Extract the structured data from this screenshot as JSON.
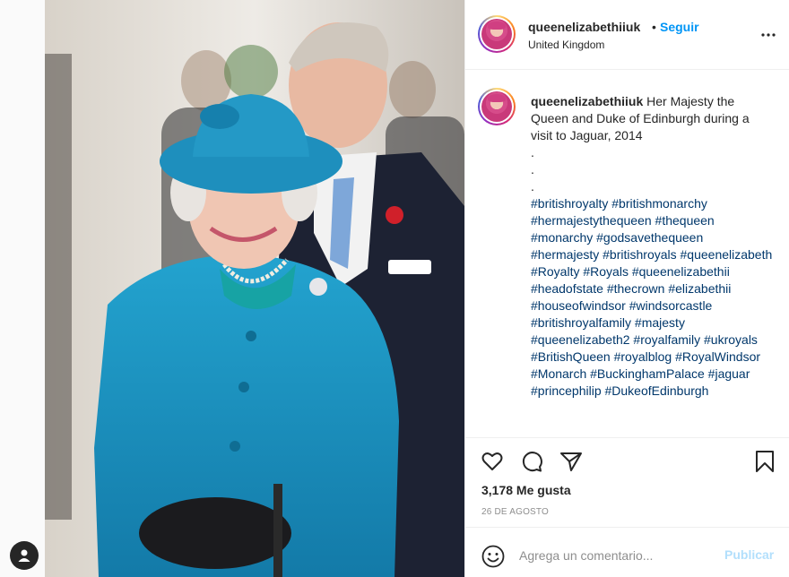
{
  "header": {
    "username": "queenelizabethiiuk",
    "separator": "•",
    "follow_label": "Seguir",
    "location": "United Kingdom",
    "more_icon": "more-horizontal-icon"
  },
  "caption": {
    "username": "queenelizabethiiuk",
    "text": "Her Majesty the Queen and Duke of Edinburgh during a visit to Jaguar, 2014",
    "dots": [
      ".",
      ".",
      "."
    ],
    "hashtags": "#britishroyalty #britishmonarchy #hermajestythequeen #thequeen #monarchy #godsavethequeen #hermajesty #britishroyals #queenelizabeth #Royalty #Royals #queenelizabethii #headofstate #thecrown #elizabethii #houseofwindsor #windsorcastle #britishroyalfamily #majesty #queenelizabeth2 #royalfamily #ukroyals #BritishQueen #royalblog #RoyalWindsor #Monarch #BuckinghamPalace #jaguar #princephilip #DukeofEdinburgh"
  },
  "actions": {
    "icons": [
      "heart-icon",
      "comment-icon",
      "share-icon",
      "bookmark-icon"
    ],
    "likes": "3,178 Me gusta",
    "date": "26 DE AGOSTO"
  },
  "comment": {
    "placeholder": "Agrega un comentario...",
    "post_label": "Publicar"
  },
  "colors": {
    "link": "#0095f6",
    "hashtag": "#00376b",
    "post_disabled": "#b2dffc",
    "coat": "#1c8fbf"
  }
}
